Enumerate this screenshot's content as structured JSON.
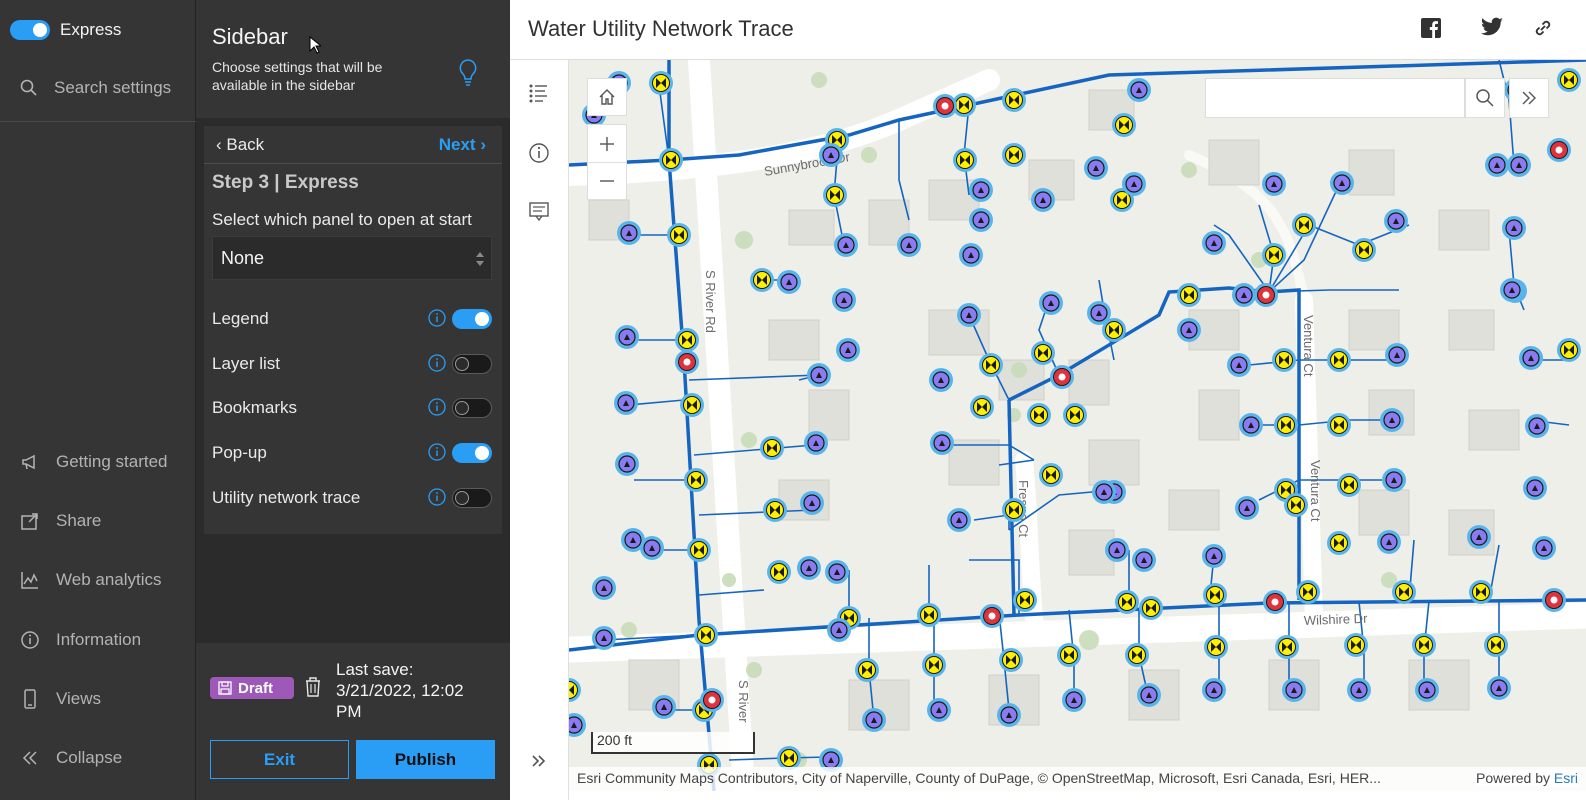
{
  "nav": {
    "express_label": "Express",
    "search_placeholder": "Search settings",
    "items": [
      {
        "label": "Getting started",
        "icon": "megaphone-icon"
      },
      {
        "label": "Share",
        "icon": "share-icon"
      },
      {
        "label": "Web analytics",
        "icon": "analytics-icon"
      },
      {
        "label": "Information",
        "icon": "information-icon"
      },
      {
        "label": "Views",
        "icon": "mobile-icon"
      },
      {
        "label": "Collapse",
        "icon": "collapse-icon"
      }
    ]
  },
  "panel": {
    "title": "Sidebar",
    "description": "Choose settings that will be available in the sidebar",
    "back_label": "Back",
    "next_label": "Next",
    "step_title": "Step 3 | Express",
    "select_label": "Select which panel to open at start",
    "select_value": "None",
    "options": [
      {
        "label": "Legend",
        "enabled": true
      },
      {
        "label": "Layer list",
        "enabled": false
      },
      {
        "label": "Bookmarks",
        "enabled": false
      },
      {
        "label": "Pop-up",
        "enabled": true
      },
      {
        "label": "Utility network trace",
        "enabled": false
      }
    ],
    "draft_label": "Draft",
    "last_save_label": "Last save:",
    "last_save_value": "3/21/2022, 12:02 PM",
    "exit_label": "Exit",
    "publish_label": "Publish"
  },
  "app": {
    "title": "Water Utility Network Trace",
    "social": [
      "facebook-icon",
      "twitter-icon",
      "link-icon"
    ],
    "streets": [
      "Sunnybrook Dr",
      "S River Rd",
      "Fresno Ct",
      "Ventura Ct",
      "Ventura Ct",
      "Wilshire Dr",
      "S River"
    ],
    "scale_label": "200 ft",
    "attribution": "Esri Community Maps Contributors, City of Naperville, County of DuPage, © OpenStreetMap, Microsoft, Esri Canada, Esri, HER...",
    "powered_by": "Powered by",
    "esri": "Esri"
  },
  "colors": {
    "accent": "#2a9df4",
    "draft": "#9e59b8",
    "pipe": "#1565c0"
  }
}
